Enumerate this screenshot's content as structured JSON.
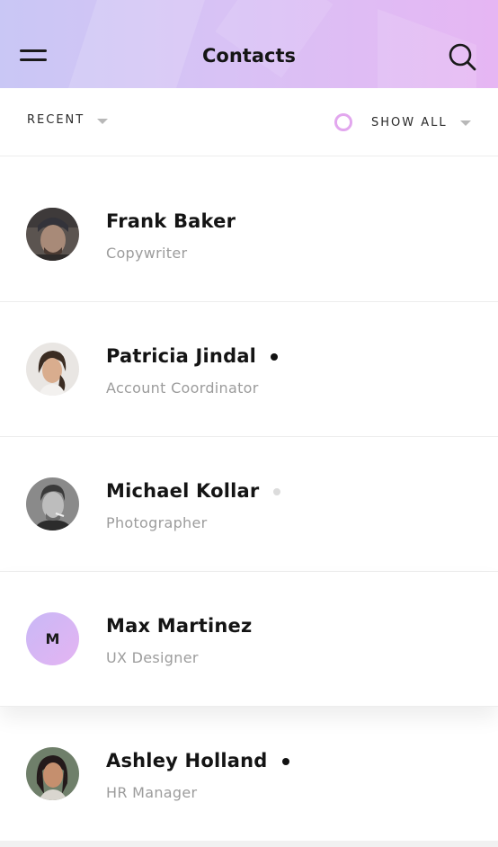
{
  "header": {
    "title": "Contacts",
    "menu_icon": "hamburger-menu-icon",
    "search_icon": "search-icon",
    "gradient": [
      "#c9c7f5",
      "#e6b6f3"
    ]
  },
  "filters": {
    "recent_label": "RECENT",
    "show_all_label": "SHOW ALL",
    "accent_color": "#e2a7ee"
  },
  "contacts": [
    {
      "name": "Frank Baker",
      "role": "Copywriter",
      "status": "none",
      "avatar": "photo"
    },
    {
      "name": "Patricia Jindal",
      "role": "Account Coordinator",
      "status": "online",
      "avatar": "photo"
    },
    {
      "name": "Michael Kollar",
      "role": "Photographer",
      "status": "away",
      "avatar": "photo"
    },
    {
      "name": "Max Martinez",
      "role": "UX Designer",
      "status": "none",
      "avatar": "initial",
      "initial": "M"
    },
    {
      "name": "Ashley Holland",
      "role": "HR Manager",
      "status": "online",
      "avatar": "photo"
    }
  ]
}
